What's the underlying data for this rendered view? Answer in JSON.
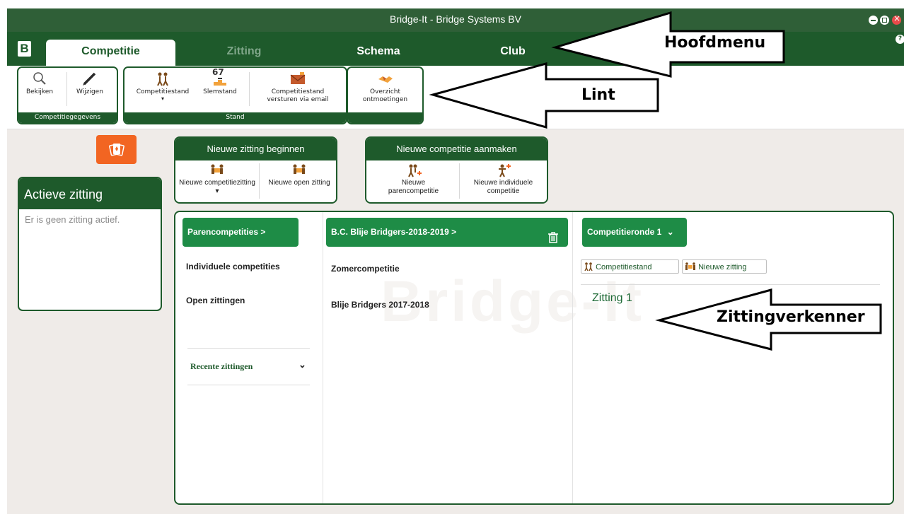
{
  "window": {
    "title": "Bridge-It - Bridge Systems BV"
  },
  "menu": {
    "logo": "B",
    "help": "?",
    "tabs": [
      {
        "label": "Competitie"
      },
      {
        "label": "Zitting"
      },
      {
        "label": "Schema"
      },
      {
        "label": "Club"
      }
    ]
  },
  "ribbon": {
    "groups": [
      {
        "footer": "Competitiegegevens",
        "buttons": [
          "Bekijken",
          "Wijzigen"
        ]
      },
      {
        "footer": "Stand",
        "buttons": [
          "Competitiestand",
          "Slemstand",
          "Competitiestand versturen via email"
        ]
      },
      {
        "footer": "",
        "buttons": [
          "Overzicht ontmoetingen"
        ]
      }
    ],
    "slem_number": "67"
  },
  "actieve": {
    "title": "Actieve zitting",
    "empty": "Er is geen zitting actief."
  },
  "nieuwe_zitting": {
    "title": "Nieuwe zitting beginnen",
    "btn1": "Nieuwe competitiezitting",
    "btn1_caret": "▾",
    "btn2": "Nieuwe open zitting"
  },
  "nieuwe_competitie": {
    "title": "Nieuwe competitie aanmaken",
    "btn1": "Nieuwe parencompetitie",
    "btn2": "Nieuwe individuele competitie"
  },
  "explorer": {
    "col1": {
      "selected": "Parencompetities  >",
      "items": [
        "Individuele competities",
        "Open zittingen"
      ],
      "recent": "Recente zittingen",
      "recent_chevron": "⌄"
    },
    "col2": {
      "selected": "B.C. Blije Bridgers-2018-2019  >",
      "items": [
        "Zomercompetitie",
        "Blije Bridgers 2017-2018"
      ]
    },
    "col3": {
      "selected": "Competitieronde 1",
      "selected_chevron": "⌄",
      "btn_stand": "Competitiestand",
      "btn_new": "Nieuwe zitting",
      "sessions": [
        "Zitting 1"
      ]
    },
    "watermark": "Bridge-It"
  },
  "callouts": {
    "menu": "Hoofdmenu",
    "ribbon": "Lint",
    "explorer": "Zittingverkenner"
  },
  "colors": {
    "brand_green": "#1e5a2b",
    "accent_green": "#1e8c46",
    "orange": "#f26522"
  }
}
